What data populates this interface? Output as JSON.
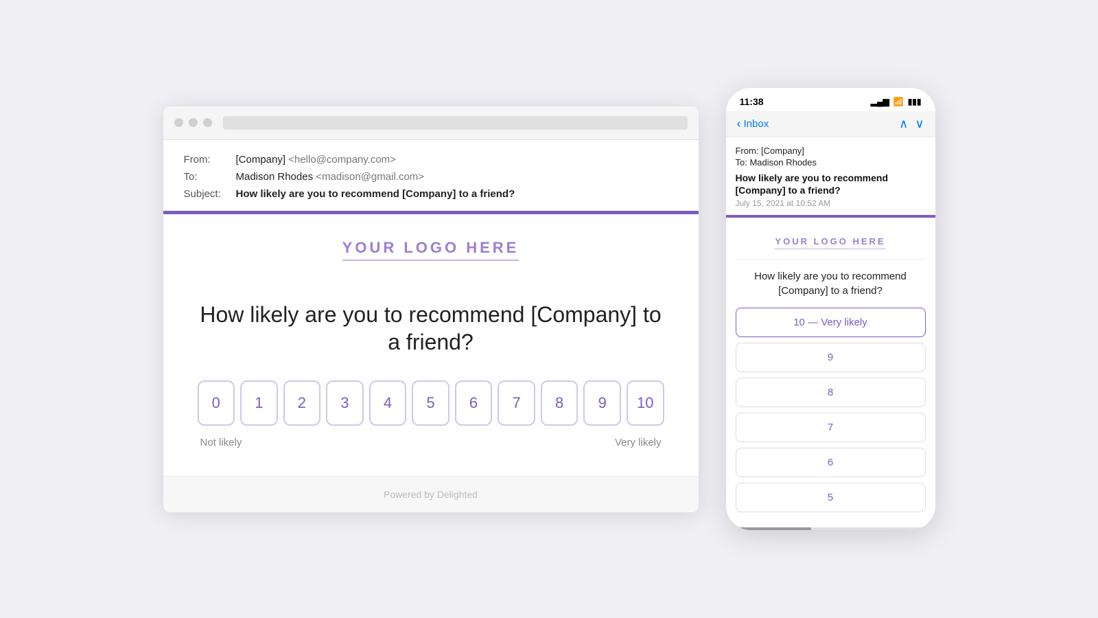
{
  "desktop": {
    "window": {
      "address_bar_placeholder": ""
    },
    "email": {
      "from_label": "From:",
      "from_name": "[Company]",
      "from_email": "<hello@company.com>",
      "to_label": "To:",
      "to_name": "Madison Rhodes",
      "to_email": "<madison@gmail.com>",
      "subject_label": "Subject:",
      "subject_text": "How likely are you to recommend [Company] to a friend?"
    },
    "logo": {
      "text": "YOUR LOGO HERE"
    },
    "survey": {
      "question": "How likely are you to recommend [Company] to a friend?",
      "scale": [
        "0",
        "1",
        "2",
        "3",
        "4",
        "5",
        "6",
        "7",
        "8",
        "9",
        "10"
      ],
      "label_left": "Not likely",
      "label_right": "Very likely"
    },
    "footer": {
      "text": "Powered by Delighted"
    }
  },
  "mobile": {
    "status_bar": {
      "time": "11:38",
      "signal": "▂▄▆",
      "wifi": "wifi",
      "battery": "battery"
    },
    "nav": {
      "back_label": "Inbox",
      "up_arrow": "∧",
      "down_arrow": "∨"
    },
    "email": {
      "from": "From: [Company]",
      "to": "To: Madison Rhodes",
      "subject": "How likely are you to recommend [Company] to a friend?",
      "date": "July 15, 2021 at 10:52 AM"
    },
    "logo": {
      "text": "YOUR LOGO HERE"
    },
    "survey": {
      "question": "How likely are you to recommend [Company] to a friend?",
      "options": [
        {
          "label": "10 — Very likely",
          "selected": true
        },
        {
          "label": "9",
          "selected": false
        },
        {
          "label": "8",
          "selected": false
        },
        {
          "label": "7",
          "selected": false
        },
        {
          "label": "6",
          "selected": false
        },
        {
          "label": "5",
          "selected": false
        }
      ]
    }
  }
}
